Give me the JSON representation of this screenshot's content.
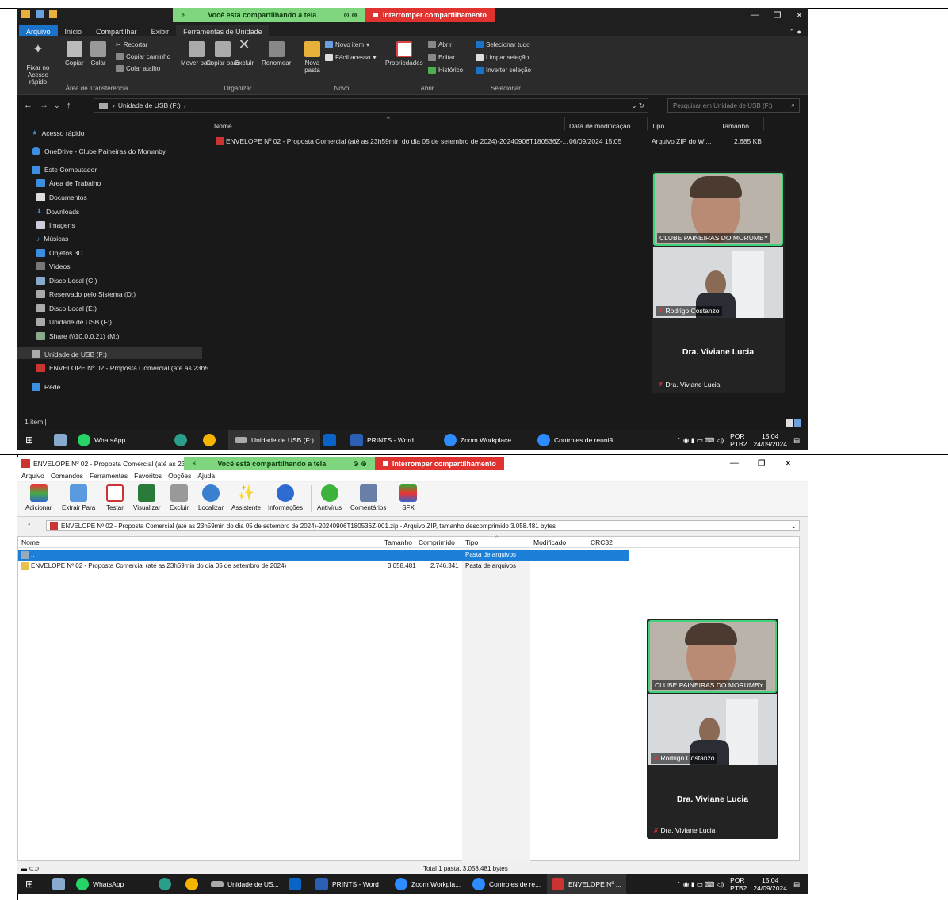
{
  "screen1": {
    "share": {
      "sharing_text": "Você está compartilhando a tela",
      "stop_text": "Interromper compartilhamento"
    },
    "ribbon_tabs": [
      "Arquivo",
      "Início",
      "Compartilhar",
      "Exibir",
      "Ferramentas de Unidade"
    ],
    "ribbon": {
      "pin": "Fixar no Acesso rápido",
      "copy": "Copiar",
      "paste": "Colar",
      "cut": "Recortar",
      "copy_path": "Copiar caminho",
      "paste_shortcut": "Colar atalho",
      "clipboard_group": "Área de Transferência",
      "move_to": "Mover para",
      "copy_to": "Copiar para",
      "delete": "Excluir",
      "rename": "Renomear",
      "organize_group": "Organizar",
      "new_folder": "Nova pasta",
      "new_item": "Novo item",
      "easy_access": "Fácil acesso",
      "new_group": "Novo",
      "properties": "Propriedades",
      "open": "Abrir",
      "edit": "Editar",
      "history": "Histórico",
      "open_group": "Abrir",
      "select_all": "Selecionar tudo",
      "select_none": "Limpar seleção",
      "invert_selection": "Inverter seleção",
      "select_group": "Selecionar"
    },
    "address": {
      "path": "Unidade de USB (F:)",
      "search_placeholder": "Pesquisar em Unidade de USB (F:)"
    },
    "nav": {
      "quick_access": "Acesso rápido",
      "onedrive": "OneDrive - Clube Paineiras do Morumby",
      "this_pc": "Este Computador",
      "items": [
        "Área de Trabalho",
        "Documentos",
        "Downloads",
        "Imagens",
        "Músicas",
        "Objetos 3D",
        "Vídeos",
        "Disco Local (C:)",
        "Reservado pelo Sistema (D:)",
        "Disco Local (E:)",
        "Unidade de USB (F:)",
        "Share (\\\\10.0.0.21) (M:)"
      ],
      "usb_drive": "Unidade de USB (F:)",
      "usb_file": "ENVELOPE Nº 02 - Proposta Comercial (até as 23h5",
      "network": "Rede"
    },
    "columns": {
      "name": "Nome",
      "modified": "Data de modificação",
      "type": "Tipo",
      "size": "Tamanho"
    },
    "file": {
      "name": "ENVELOPE Nº 02 - Proposta Comercial (até as 23h59min do dia 05 de setembro de 2024)-20240906T180536Z-...",
      "modified": "06/09/2024 15:05",
      "type": "Arquivo ZIP do Wi...",
      "size": "2.685 KB"
    },
    "status": "1 item",
    "taskbar": {
      "whatsapp": "WhatsApp",
      "usb": "Unidade de USB (F:)",
      "word": "PRINTS - Word",
      "zoom": "Zoom Workplace",
      "zoom_controls": "Controles de reuniã...",
      "lang1": "POR",
      "lang2": "PTB2",
      "time": "15:04",
      "date": "24/09/2024"
    },
    "video": {
      "p1": "CLUBE PAINEIRAS DO MORUMBY",
      "p2": "Rodrigo Costanzo",
      "p3_big": "Dra. Viviane Lucia",
      "p3": "Dra. Viviane Lucia"
    }
  },
  "screen2": {
    "title": "ENVELOPE Nº 02 - Proposta Comercial (até as 23h5",
    "share": {
      "sharing_text": "Você está compartilhando a tela",
      "stop_text": "Interromper compartilhamento"
    },
    "menu": [
      "Arquivo",
      "Comandos",
      "Ferramentas",
      "Favoritos",
      "Opções",
      "Ajuda"
    ],
    "toolbar": [
      "Adicionar",
      "Extrair Para",
      "Testar",
      "Visualizar",
      "Excluir",
      "Localizar",
      "Assistente",
      "Informações",
      "Antivírus",
      "Comentários",
      "SFX"
    ],
    "path": "ENVELOPE Nº 02 - Proposta Comercial (até as 23h59min do dia 05 de setembro de 2024)-20240906T180536Z-001.zip - Arquivo ZIP, tamanho descomprimido 3.058.481 bytes",
    "columns": {
      "name": "Nome",
      "size": "Tamanho",
      "packed": "Comprimido",
      "type": "Tipo",
      "modified": "Modificado",
      "crc": "CRC32"
    },
    "rows": [
      {
        "name": "..",
        "size": "",
        "packed": "",
        "type": "Pasta de arquivos"
      },
      {
        "name": "ENVELOPE Nº 02 - Proposta Comercial (até as 23h59min do dia 05 de setembro de 2024)",
        "size": "3.058.481",
        "packed": "2.746.341",
        "type": "Pasta de arquivos"
      }
    ],
    "status": "Total 1 pasta, 3.058.481 bytes",
    "taskbar": {
      "whatsapp": "WhatsApp",
      "usb": "Unidade de US...",
      "word": "PRINTS - Word",
      "zoom": "Zoom Workpla...",
      "zoom_controls": "Controles de re...",
      "winrar": "ENVELOPE Nº ...",
      "lang1": "POR",
      "lang2": "PTB2",
      "time": "15:04",
      "date": "24/09/2024"
    },
    "video": {
      "p1": "CLUBE PAINEIRAS DO MORUMBY",
      "p2": "Rodrigo Costanzo",
      "p3_big": "Dra. Viviane Lucia",
      "p3": "Dra. Viviane Lucia"
    }
  }
}
